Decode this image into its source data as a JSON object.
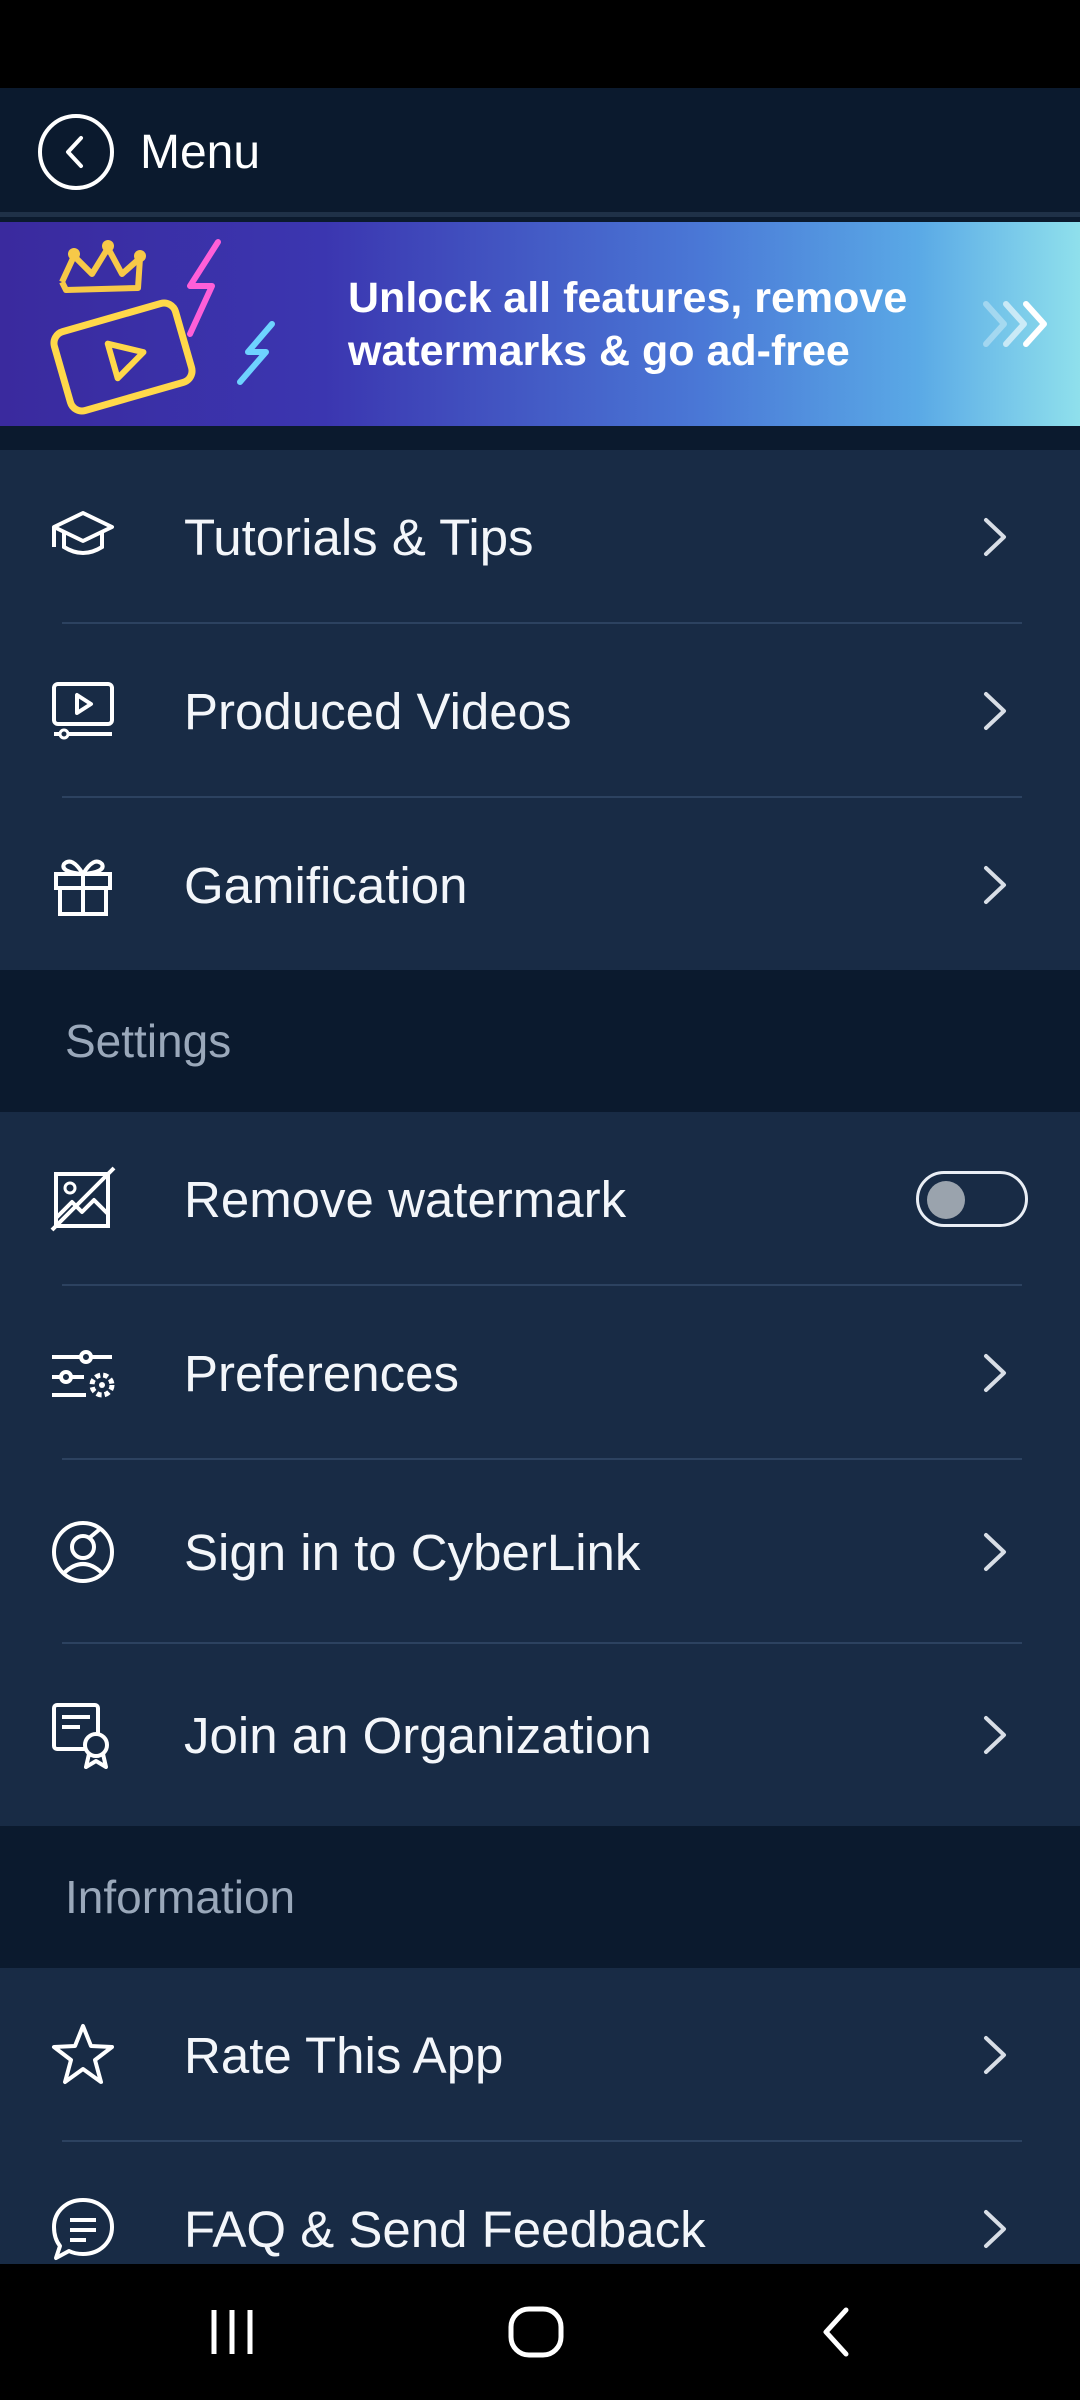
{
  "header": {
    "title": "Menu"
  },
  "promo": {
    "text": "Unlock all features, remove watermarks & go ad-free"
  },
  "main_items": [
    {
      "label": "Tutorials & Tips",
      "icon": "graduation-cap-icon"
    },
    {
      "label": "Produced Videos",
      "icon": "video-screen-icon"
    },
    {
      "label": "Gamification",
      "icon": "gift-icon"
    }
  ],
  "settings": {
    "title": "Settings",
    "items": [
      {
        "label": "Remove watermark",
        "icon": "no-image-icon",
        "toggle": false
      },
      {
        "label": "Preferences",
        "icon": "sliders-gear-icon"
      },
      {
        "label": "Sign in to CyberLink",
        "icon": "account-icon"
      },
      {
        "label": "Join an Organization",
        "icon": "certificate-icon"
      }
    ]
  },
  "information": {
    "title": "Information",
    "items": [
      {
        "label": "Rate This App",
        "icon": "star-icon"
      },
      {
        "label": "FAQ & Send Feedback",
        "icon": "chat-bubble-icon"
      }
    ]
  },
  "colors": {
    "background": "#0b1a2e",
    "row_background": "#182b45",
    "divider": "#2c4260",
    "section_title": "#9aa8ba"
  }
}
